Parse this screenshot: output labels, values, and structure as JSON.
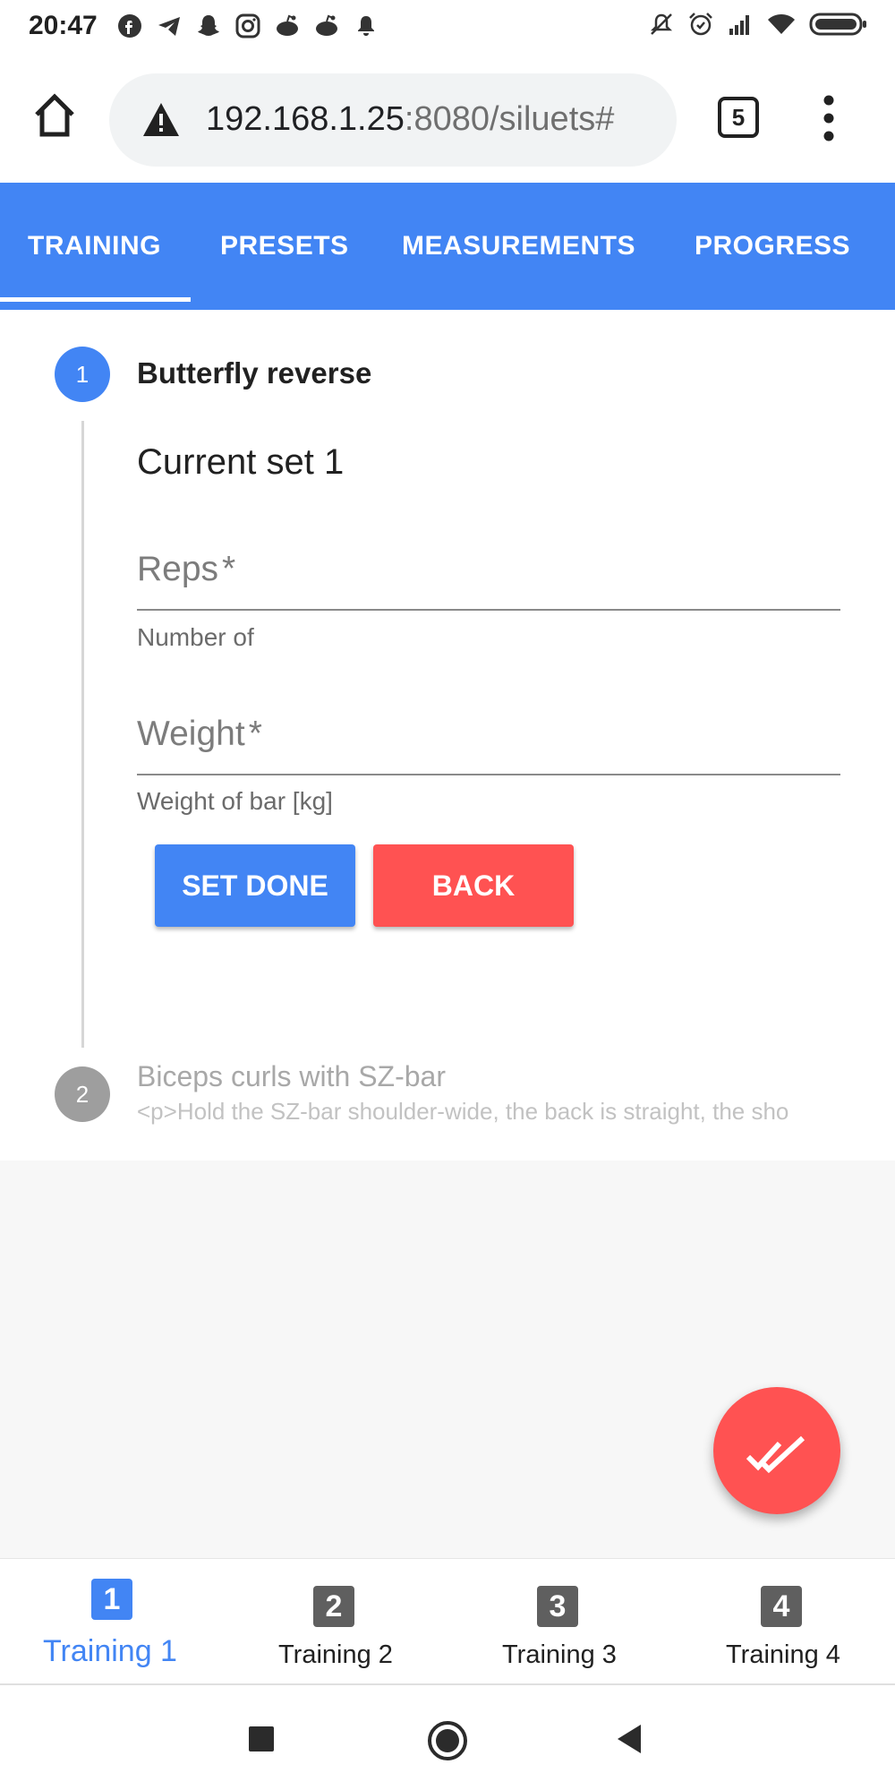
{
  "status_bar": {
    "time": "20:47",
    "left_icons": [
      "facebook-icon",
      "telegram-icon",
      "snapchat-icon",
      "instagram-icon",
      "reddit-icon",
      "reddit-icon",
      "notification-bell-icon"
    ],
    "right_icons": [
      "mute-icon",
      "alarm-icon",
      "signal-icon",
      "wifi-icon",
      "battery-icon"
    ]
  },
  "browser": {
    "url_host": "192.168.1.25",
    "url_rest": ":8080/siluets#",
    "tab_count": "5"
  },
  "app_tabs": [
    {
      "label": "TRAINING",
      "active": true
    },
    {
      "label": "PRESETS",
      "active": false
    },
    {
      "label": "MEASUREMENTS",
      "active": false
    },
    {
      "label": "PROGRESS",
      "active": false
    }
  ],
  "stepper": {
    "step1": {
      "number": "1",
      "title": "Butterfly reverse",
      "current_set": "Current set 1",
      "reps_label": "Reps",
      "reps_help": "Number of",
      "weight_label": "Weight",
      "weight_help": "Weight of bar [kg]",
      "required_mark": "*",
      "set_done_label": "SET DONE",
      "back_label": "BACK"
    },
    "step2": {
      "number": "2",
      "title": "Biceps curls with SZ-bar",
      "description": "<p>Hold the SZ-bar shoulder-wide, the back is straight, the sho"
    }
  },
  "fab": {
    "icon": "double-check-icon"
  },
  "bottom_nav": [
    {
      "number": "1",
      "label": "Training 1",
      "active": true
    },
    {
      "number": "2",
      "label": "Training 2",
      "active": false
    },
    {
      "number": "3",
      "label": "Training 3",
      "active": false
    },
    {
      "number": "4",
      "label": "Training 4",
      "active": false
    }
  ],
  "colors": {
    "primary": "#4285f4",
    "accent": "#ff5252",
    "inactive_step": "#9e9e9e",
    "nav_inactive_icon": "#5f5f5f"
  }
}
